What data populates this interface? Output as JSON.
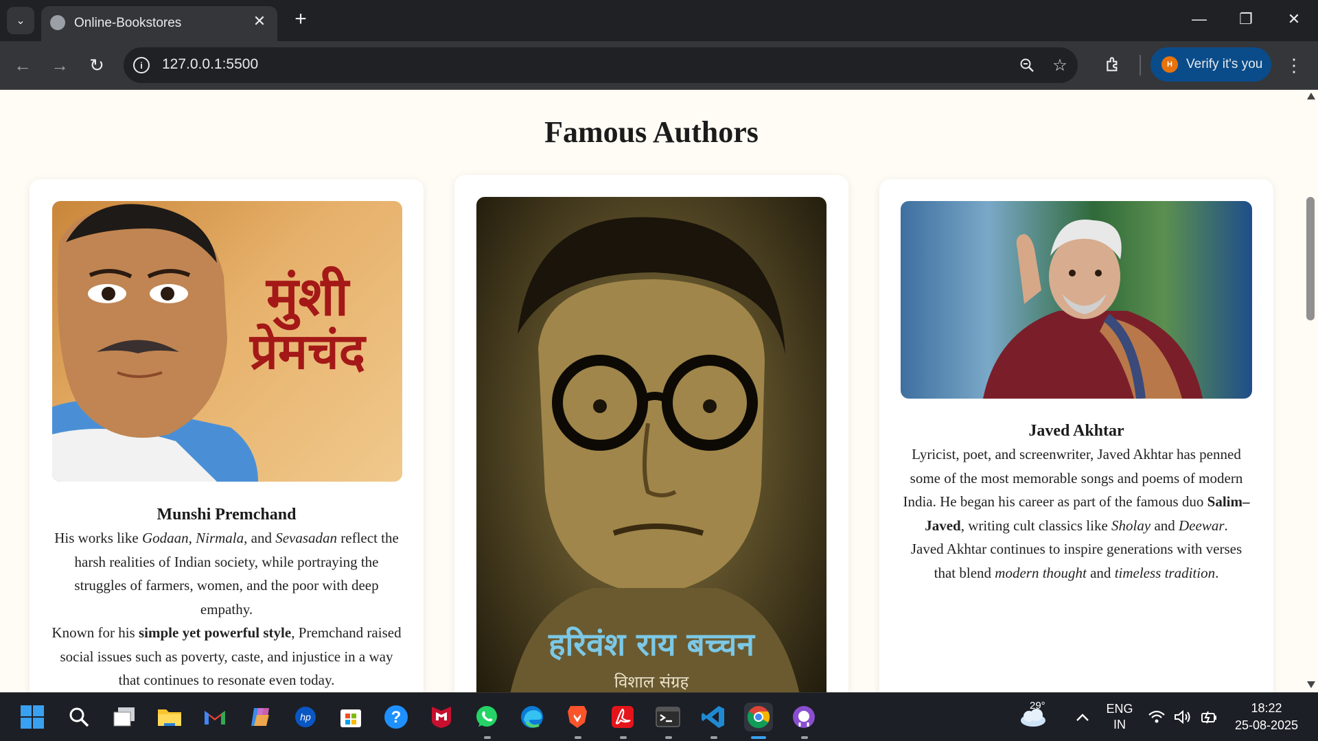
{
  "browser": {
    "tab_title": "Online-Bookstores",
    "url": "127.0.0.1:5500",
    "profile_label": "Verify it's you",
    "profile_initial": "H"
  },
  "page": {
    "heading": "Famous Authors"
  },
  "authors": [
    {
      "name": "Munshi Premchand",
      "image_text_line1": "मुंशी",
      "image_text_line2": "प्रेमचंद",
      "bio_p1_pre": "His works like ",
      "bio_p1_b1": "Godaan",
      "bio_p1_s1": ", ",
      "bio_p1_b2": "Nirmala",
      "bio_p1_s2": ", and ",
      "bio_p1_b3": "Sevasadan",
      "bio_p1_post": " reflect the harsh realities of Indian society, while portraying the struggles of farmers, women, and the poor with deep empathy.",
      "bio_p2_pre": "Known for his ",
      "bio_p2_strong": "simple yet powerful style",
      "bio_p2_post": ", Premchand raised social issues such as poverty, caste, and injustice in a way that continues to resonate even today."
    },
    {
      "name": "Harivansh Rai Bachchan",
      "image_text_line1": "हरिवंश राय बच्चन",
      "image_text_line2": "विशाल संग्रह"
    },
    {
      "name": "Javed Akhtar",
      "bio_p1_pre": "Lyricist, poet, and screenwriter, Javed Akhtar has penned some of the most memorable songs and poems of modern India. He began his career as part of the famous duo ",
      "bio_p1_strong": "Salim–Javed",
      "bio_p1_mid": ", writing cult classics like ",
      "bio_p1_em1": "Sholay",
      "bio_p1_and": " and ",
      "bio_p1_em2": "Deewar",
      "bio_p1_end": ".",
      "bio_p2_pre": "Javed Akhtar continues to inspire generations with verses that blend ",
      "bio_p2_em1": "modern thought",
      "bio_p2_and": " and ",
      "bio_p2_em2": "timeless tradition",
      "bio_p2_end": "."
    }
  ],
  "taskbar": {
    "weather_temp": "29°",
    "lang_line1": "ENG",
    "lang_line2": "IN",
    "time": "18:22",
    "date": "25-08-2025"
  }
}
